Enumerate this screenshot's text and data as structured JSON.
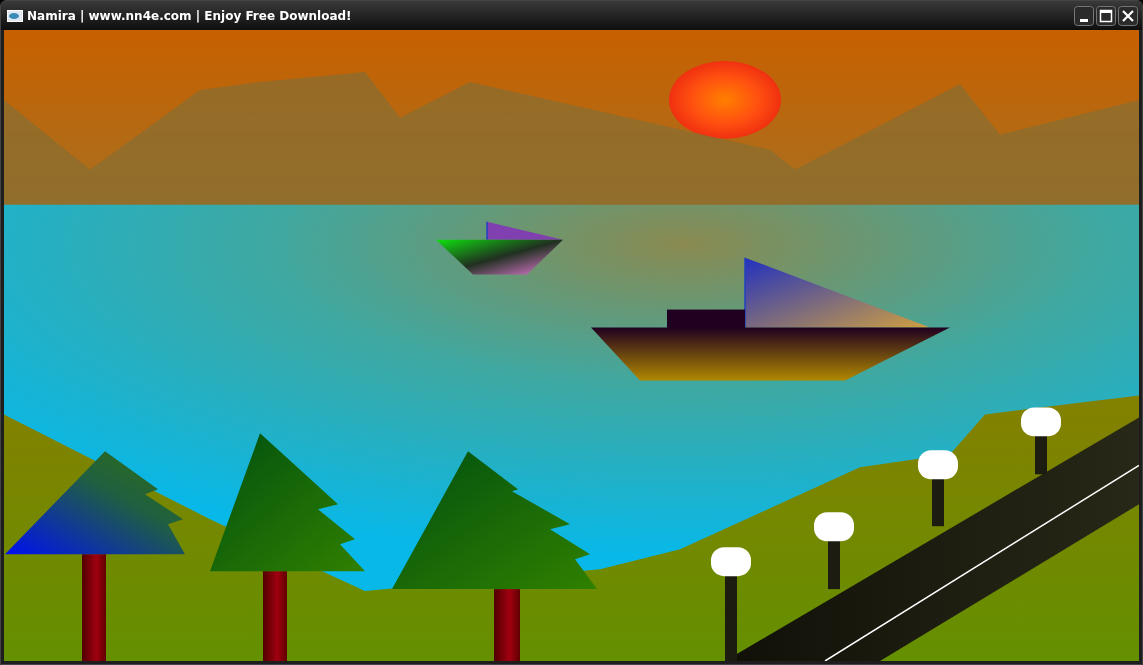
{
  "window": {
    "title": "Namira | www.nn4e.com | Enjoy Free Download!"
  }
}
